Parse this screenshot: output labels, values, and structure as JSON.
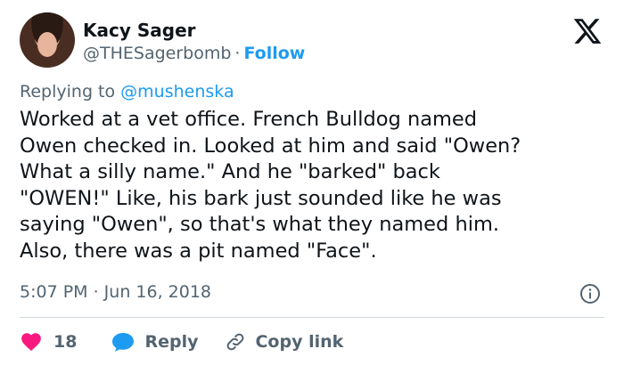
{
  "author": {
    "name": "Kacy Sager",
    "handle": "@THESagerbomb",
    "separator": "·",
    "follow_label": "Follow"
  },
  "reply_context": {
    "prefix": "Replying to",
    "mention": "@mushenska"
  },
  "tweet": {
    "text": "Worked at a vet office. French Bulldog named\nOwen checked in. Looked at him and said \"Owen?\nWhat a silly name.\" And he \"barked\" back\n\"OWEN!\" Like, his bark just sounded like he was\nsaying \"Owen\", so that's what they named him.\nAlso, there was a pit named \"Face\".",
    "timestamp": "5:07 PM · Jun 16, 2018"
  },
  "actions": {
    "like_count": "18",
    "reply_label": "Reply",
    "copy_link_label": "Copy link"
  },
  "icons": {
    "logo": "x-logo-icon",
    "info": "info-icon",
    "like": "heart-icon",
    "reply": "speech-bubble-icon",
    "copy": "link-icon"
  },
  "colors": {
    "accent": "#1d9bf0",
    "like": "#f91880",
    "text": "#0f1419",
    "muted": "#536471"
  }
}
